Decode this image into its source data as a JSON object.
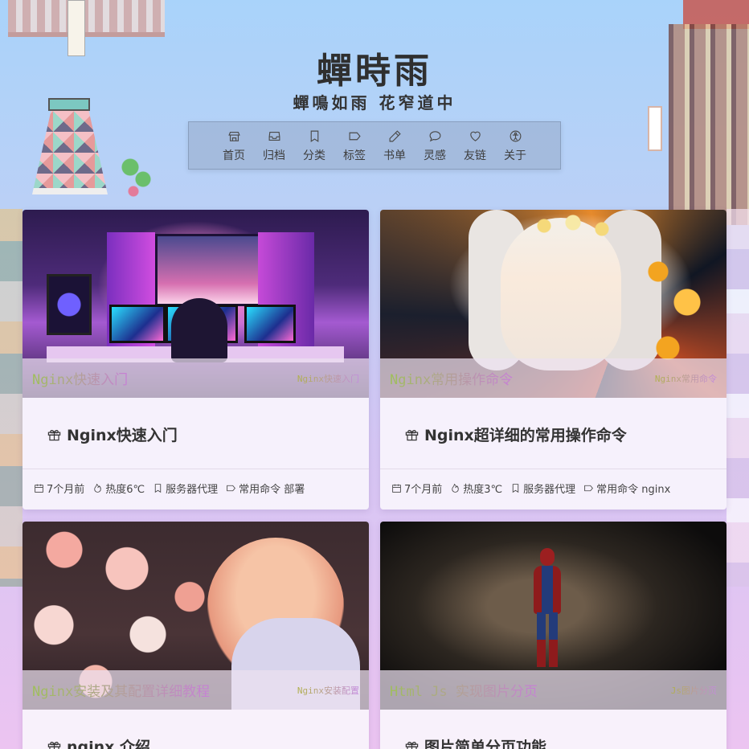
{
  "site": {
    "title": "蟬時雨",
    "subtitle": "蟬鳴如雨 花窄道中"
  },
  "nav": [
    {
      "label": "首页",
      "icon": "home-icon"
    },
    {
      "label": "归档",
      "icon": "archive-inbox-icon"
    },
    {
      "label": "分类",
      "icon": "bookmark-icon"
    },
    {
      "label": "标签",
      "icon": "tag-icon"
    },
    {
      "label": "书单",
      "icon": "pencil-icon"
    },
    {
      "label": "灵感",
      "icon": "chat-bubble-icon"
    },
    {
      "label": "友链",
      "icon": "heart-icon"
    },
    {
      "label": "关于",
      "icon": "person-circle-icon"
    }
  ],
  "posts": [
    {
      "cover_caption": "Nginx快速入门",
      "cover_tag": "Nginx快速入门",
      "title": "Nginx快速入门",
      "date": "7个月前",
      "heat": "热度6℃",
      "category": "服务器代理",
      "tags": "常用命令 部署"
    },
    {
      "cover_caption": "Nginx常用操作命令",
      "cover_tag": "Nginx常用命令",
      "title": "Nginx超详细的常用操作命令",
      "date": "7个月前",
      "heat": "热度3℃",
      "category": "服务器代理",
      "tags": "常用命令 nginx"
    },
    {
      "cover_caption": "Nginx安装及其配置详细教程",
      "cover_tag": "Nginx安装配置",
      "title": "nginx 介绍"
    },
    {
      "cover_caption": "Html Js 实现图片分页",
      "cover_tag": "Js图片分页",
      "title": "图片简单分页功能"
    }
  ]
}
